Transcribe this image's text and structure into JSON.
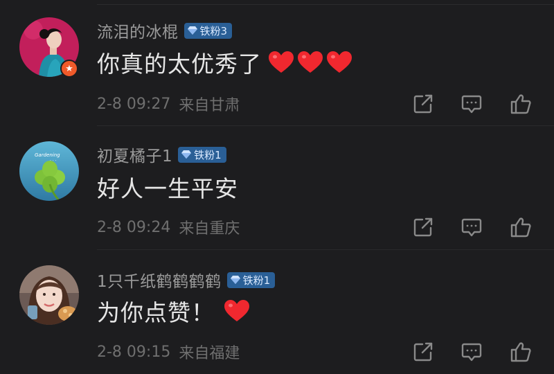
{
  "colors": {
    "background": "#1d1d1f",
    "username": "#9b9b9b",
    "text": "#e6e6e6",
    "meta": "#6f6f6f",
    "badge_bg": "#2a5f96",
    "heart": "#f0282f"
  },
  "comments": [
    {
      "username": "流泪的冰棍",
      "badge": "铁粉3",
      "text": "你真的太优秀了",
      "emoji": [
        "red-heart",
        "red-heart",
        "red-heart"
      ],
      "date": "2-8 09:27",
      "location": "来自甘肃",
      "avatar_icon": "woman-portrait-avatar",
      "avatar_badge_icon": "star-badge-icon"
    },
    {
      "username": "初夏橘子1",
      "badge": "铁粉1",
      "text": "好人一生平安",
      "emoji": [],
      "date": "2-8 09:24",
      "location": "来自重庆",
      "avatar_icon": "clover-avatar"
    },
    {
      "username": "1只千纸鹤鹤鹤鹤",
      "badge": "铁粉1",
      "text": "为你点赞！",
      "emoji": [
        "red-heart"
      ],
      "date": "2-8 09:15",
      "location": "来自福建",
      "avatar_icon": "girl-portrait-avatar"
    }
  ],
  "actions": [
    "share-icon",
    "reply-icon",
    "like-icon"
  ]
}
